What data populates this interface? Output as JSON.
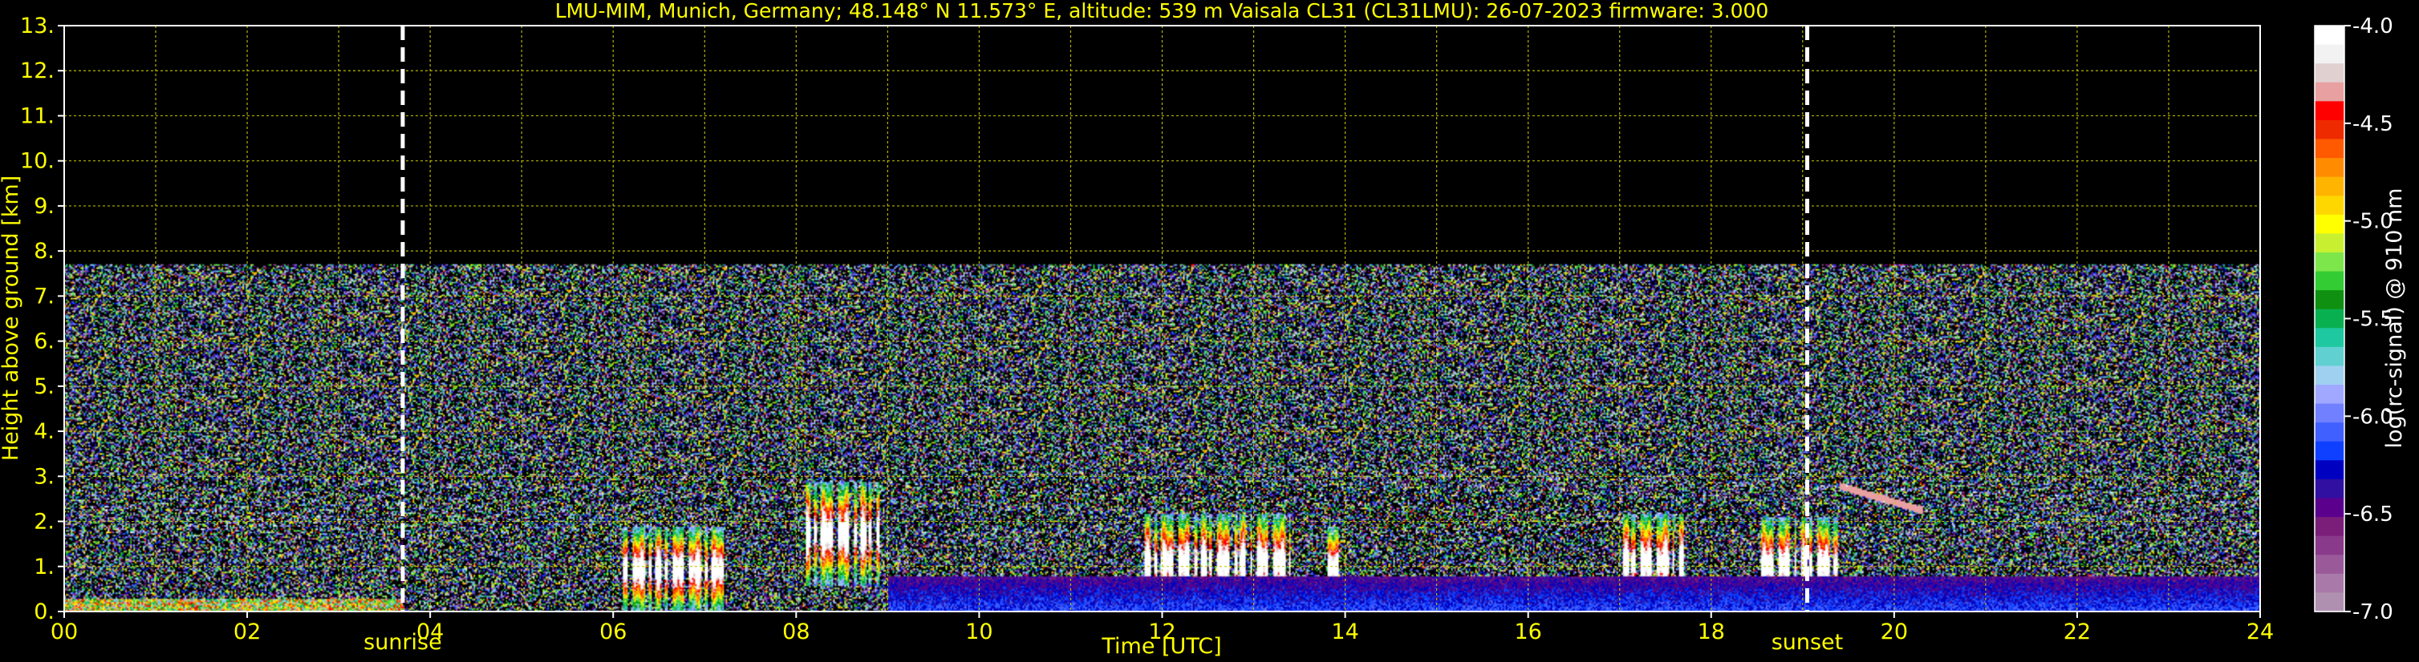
{
  "chart_data": {
    "type": "heatmap",
    "title": "LMU-MIM, Munich, Germany; 48.148° N 11.573° E, altitude: 539 m    Vaisala CL31 (CL31LMU): 26-07-2023    firmware: 3.000",
    "xlabel": "Time [UTC]",
    "ylabel": "Height above ground [km]",
    "xlim": [
      0,
      24
    ],
    "ylim": [
      0,
      13
    ],
    "x_ticks": [
      {
        "value": 0,
        "label": "00"
      },
      {
        "value": 2,
        "label": "02"
      },
      {
        "value": 4,
        "label": "04"
      },
      {
        "value": 6,
        "label": "06"
      },
      {
        "value": 8,
        "label": "08"
      },
      {
        "value": 10,
        "label": "10"
      },
      {
        "value": 12,
        "label": "12"
      },
      {
        "value": 14,
        "label": "14"
      },
      {
        "value": 16,
        "label": "16"
      },
      {
        "value": 18,
        "label": "18"
      },
      {
        "value": 20,
        "label": "20"
      },
      {
        "value": 22,
        "label": "22"
      },
      {
        "value": 24,
        "label": "24"
      }
    ],
    "y_ticks": [
      {
        "value": 0,
        "label": "0."
      },
      {
        "value": 1,
        "label": "1."
      },
      {
        "value": 2,
        "label": "2."
      },
      {
        "value": 3,
        "label": "3."
      },
      {
        "value": 4,
        "label": "4."
      },
      {
        "value": 5,
        "label": "5."
      },
      {
        "value": 6,
        "label": "6."
      },
      {
        "value": 7,
        "label": "7."
      },
      {
        "value": 8,
        "label": "8."
      },
      {
        "value": 9,
        "label": "9."
      },
      {
        "value": 10,
        "label": "10."
      },
      {
        "value": 11,
        "label": "11."
      },
      {
        "value": 12,
        "label": "12."
      },
      {
        "value": 13,
        "label": "13."
      }
    ],
    "grid": true,
    "grid_color": "#c8c800",
    "annotations": [
      {
        "label": "sunrise",
        "time": 3.7
      },
      {
        "label": "sunset",
        "time": 19.05
      }
    ],
    "signal_top_km": 7.7,
    "colorbar": {
      "label": "log(rc-signal) @ 910 nm",
      "range": [
        -7.0,
        -4.0
      ],
      "tick_labels": [
        {
          "value": -4.0,
          "label": "-4.0"
        },
        {
          "value": -4.5,
          "label": "-4.5"
        },
        {
          "value": -5.0,
          "label": "-5.0"
        },
        {
          "value": -5.5,
          "label": "-5.5"
        },
        {
          "value": -6.0,
          "label": "-6.0"
        },
        {
          "value": -6.5,
          "label": "-6.5"
        },
        {
          "value": -7.0,
          "label": "-7.0"
        }
      ],
      "colors_top_to_bottom": [
        "#ffffff",
        "#f2f2f2",
        "#e0d0d0",
        "#e8a0a0",
        "#ff0000",
        "#ee2a00",
        "#ff5a00",
        "#ff8c00",
        "#ffb400",
        "#ffd700",
        "#ffff00",
        "#c8f030",
        "#7de64b",
        "#33cc33",
        "#109010",
        "#08b050",
        "#1ec8a0",
        "#60d0d0",
        "#a0d0f0",
        "#a0a8ff",
        "#7080ff",
        "#4060ff",
        "#1040ff",
        "#0000c0",
        "#3010a0",
        "#5a008c",
        "#7a1e7a",
        "#8a3a8a",
        "#9a5a9a",
        "#a97aa9",
        "#b090b0"
      ]
    },
    "features": [
      {
        "kind": "boundary_layer",
        "time_start": 0.0,
        "time_end": 3.7,
        "height_km": 0.3
      },
      {
        "kind": "cloud_cluster",
        "time_start": 6.1,
        "time_end": 7.2,
        "base_km": 0.0,
        "top_km": 1.9
      },
      {
        "kind": "cloud_cluster",
        "time_start": 8.1,
        "time_end": 8.9,
        "base_km": 0.6,
        "top_km": 2.9
      },
      {
        "kind": "cloud_cluster",
        "time_start": 11.8,
        "time_end": 13.4,
        "base_km": 0.0,
        "top_km": 2.2
      },
      {
        "kind": "cloud_cluster",
        "time_start": 13.75,
        "time_end": 13.95,
        "base_km": 0.0,
        "top_km": 1.9
      },
      {
        "kind": "cloud_cluster",
        "time_start": 17.0,
        "time_end": 17.7,
        "base_km": 0.0,
        "top_km": 2.2
      },
      {
        "kind": "cloud_cluster",
        "time_start": 18.5,
        "time_end": 19.4,
        "base_km": 0.0,
        "top_km": 2.1
      },
      {
        "kind": "elevated_layer",
        "time_start": 19.4,
        "time_end": 20.3,
        "height_km": 2.8
      },
      {
        "kind": "surface_aerosol",
        "time_start": 9.0,
        "time_end": 24.0,
        "height_km": 0.8
      }
    ]
  }
}
